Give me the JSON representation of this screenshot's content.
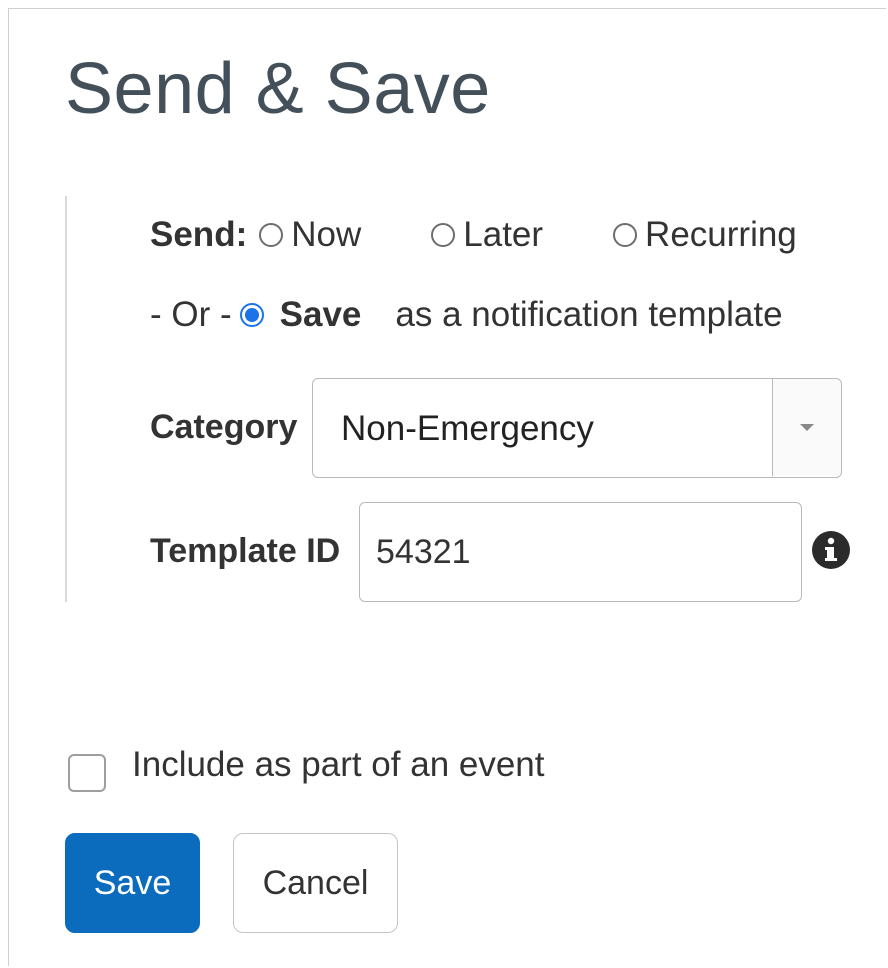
{
  "title": "Send & Save",
  "send": {
    "label": "Send:",
    "options": [
      {
        "label": "Now",
        "checked": false
      },
      {
        "label": "Later",
        "checked": false
      },
      {
        "label": "Recurring",
        "checked": false
      }
    ]
  },
  "save_option": {
    "or_text": "- Or -",
    "label": "Save",
    "suffix": "as a notification template",
    "checked": true
  },
  "category": {
    "label": "Category",
    "value": "Non-Emergency"
  },
  "template_id": {
    "label": "Template ID",
    "value": "54321"
  },
  "event_checkbox": {
    "label": "Include as part of an event",
    "checked": false
  },
  "buttons": {
    "save": "Save",
    "cancel": "Cancel"
  },
  "colors": {
    "primary": "#0b6bbd",
    "radio_selected": "#1a73e8",
    "title": "#43505a"
  },
  "icons": {
    "info": "info-circle-icon",
    "dropdown": "caret-down-icon"
  }
}
